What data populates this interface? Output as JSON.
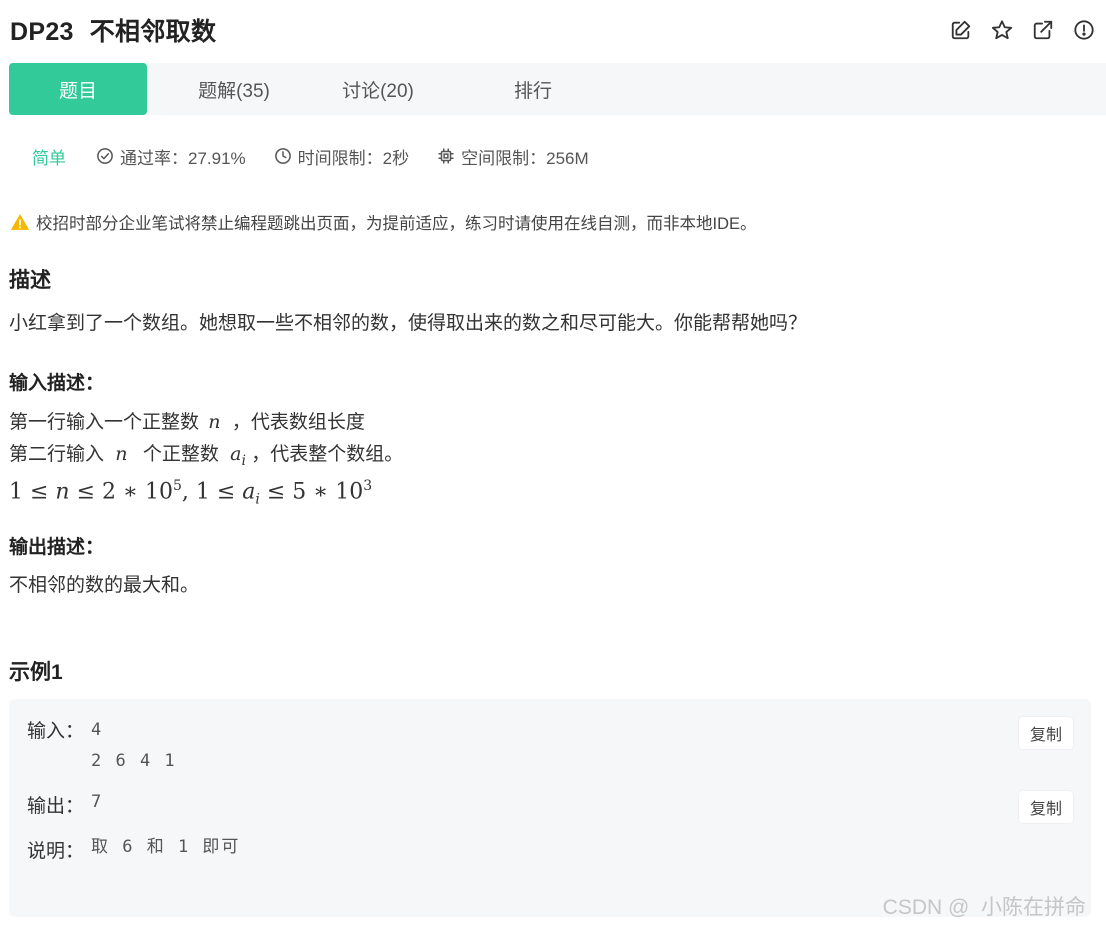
{
  "problem": {
    "code": "DP23",
    "name": "不相邻取数"
  },
  "header_icons": [
    "edit-icon",
    "star-icon",
    "external-link-icon",
    "report-icon"
  ],
  "tabs": [
    {
      "label": "题目",
      "active": true
    },
    {
      "label": "题解(35)",
      "active": false
    },
    {
      "label": "讨论(20)",
      "active": false
    },
    {
      "label": "排行",
      "active": false
    }
  ],
  "meta": {
    "difficulty": "简单",
    "pass_rate": "通过率：27.91%",
    "time_limit": "时间限制：2秒",
    "space_limit": "空间限制：256M"
  },
  "notice": "校招时部分企业笔试将禁止编程题跳出页面，为提前适应，练习时请使用在线自测，而非本地IDE。",
  "description": {
    "heading": "描述",
    "text": "小红拿到了一个数组。她想取一些不相邻的数，使得取出来的数之和尽可能大。你能帮帮她吗？"
  },
  "input_desc": {
    "heading": "输入描述：",
    "line1_pre": "第一行输入一个正整数",
    "line1_var": "n",
    "line1_post": "，代表数组长度",
    "line2_pre": "第二行输入",
    "line2_var": "n",
    "line2_mid": "个正整数",
    "line2_var2": "a",
    "line2_sub": "i",
    "line2_post": "，代表整个数组。",
    "constraint_a": "1 ≤ ",
    "constraint_n": "n",
    "constraint_b": " ≤ 2 ∗ 10",
    "constraint_exp1": "5",
    "constraint_c": ", 1 ≤ ",
    "constraint_a_var": "a",
    "constraint_a_sub": "i",
    "constraint_d": " ≤ 5 ∗ 10",
    "constraint_exp2": "3"
  },
  "output_desc": {
    "heading": "输出描述：",
    "text": "不相邻的数的最大和。"
  },
  "example": {
    "heading": "示例1",
    "input_label": "输入：",
    "input_value": "4\n2 6 4 1",
    "output_label": "输出：",
    "output_value": "7",
    "explain_label": "说明：",
    "explain_value": "取 6 和 1 即可",
    "copy_label": "复制"
  },
  "watermark": "CSDN @  小陈在拼命",
  "colors": {
    "accent": "#32ca99",
    "warning": "#f5b800"
  }
}
